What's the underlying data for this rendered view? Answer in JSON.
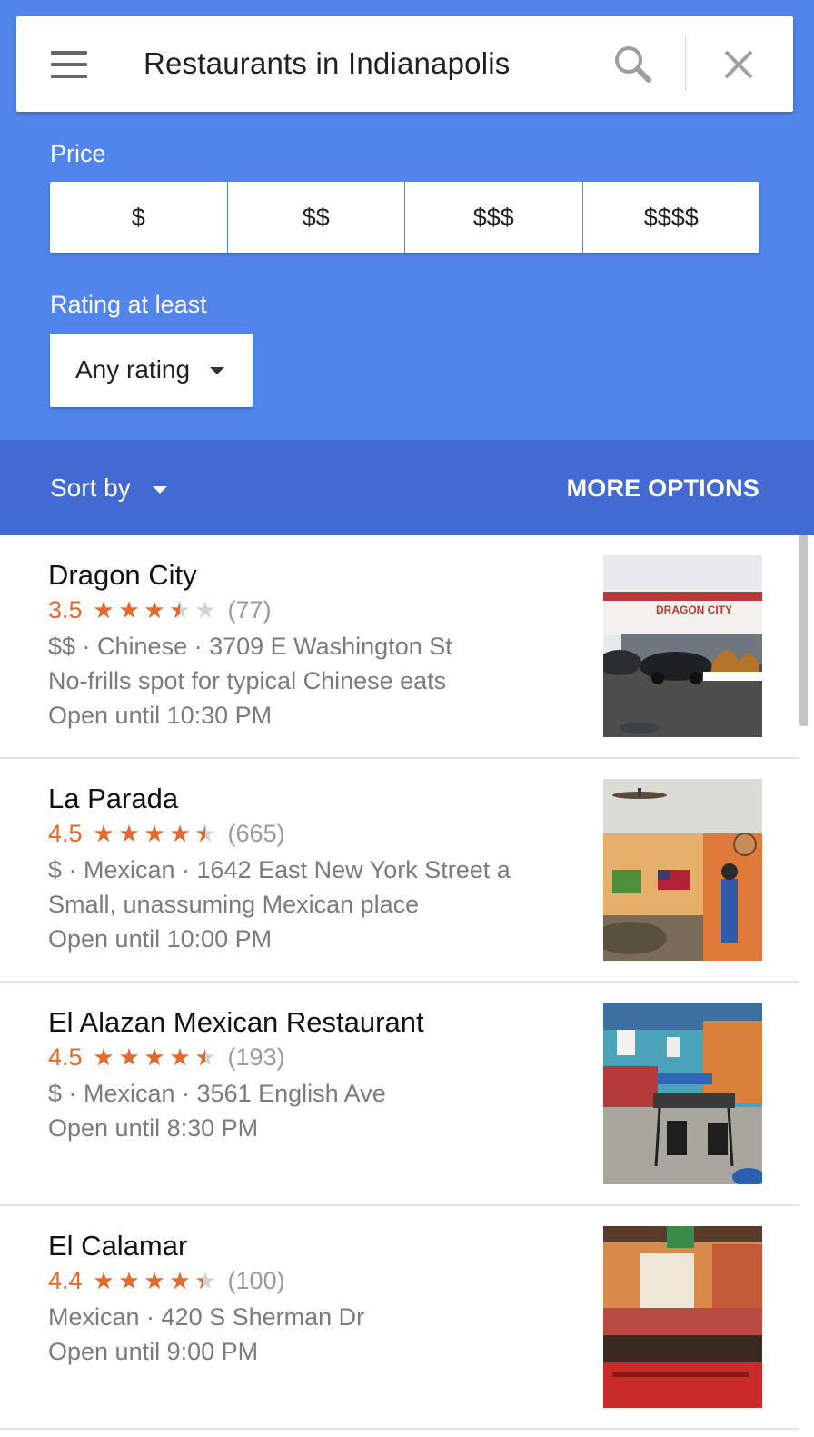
{
  "search": {
    "query": "Restaurants in Indianapolis"
  },
  "filters": {
    "price_label": "Price",
    "price_options": [
      "$",
      "$$",
      "$$$",
      "$$$$"
    ],
    "rating_label": "Rating at least",
    "rating_value": "Any rating"
  },
  "sortbar": {
    "sort_label": "Sort by",
    "more_options": "MORE OPTIONS"
  },
  "results": [
    {
      "name": "Dragon City",
      "rating": "3.5",
      "reviews": "(77)",
      "details": "$$ · Chinese · 3709 E Washington St",
      "description": "No-frills spot for typical Chinese eats",
      "hours": "Open until 10:30 PM",
      "sign_text": "DRAGON CITY"
    },
    {
      "name": "La Parada",
      "rating": "4.5",
      "reviews": "(665)",
      "details": "$ · Mexican · 1642 East New York Street a",
      "description": "Small, unassuming Mexican place",
      "hours": "Open until 10:00 PM"
    },
    {
      "name": "El Alazan Mexican Restaurant",
      "rating": "4.5",
      "reviews": "(193)",
      "details": "$ · Mexican · 3561 English Ave",
      "description": "Open until 8:30 PM",
      "hours": ""
    },
    {
      "name": "El Calamar",
      "rating": "4.4",
      "reviews": "(100)",
      "details": "Mexican · 420 S Sherman Dr",
      "description": "Open until 9:00 PM",
      "hours": ""
    }
  ],
  "colors": {
    "header": "#5185ec",
    "sortbar": "#426ad0",
    "star": "#e26a2c"
  },
  "icons": [
    "menu-icon",
    "search-icon",
    "close-icon",
    "dropdown-caret-icon",
    "star-icon"
  ]
}
